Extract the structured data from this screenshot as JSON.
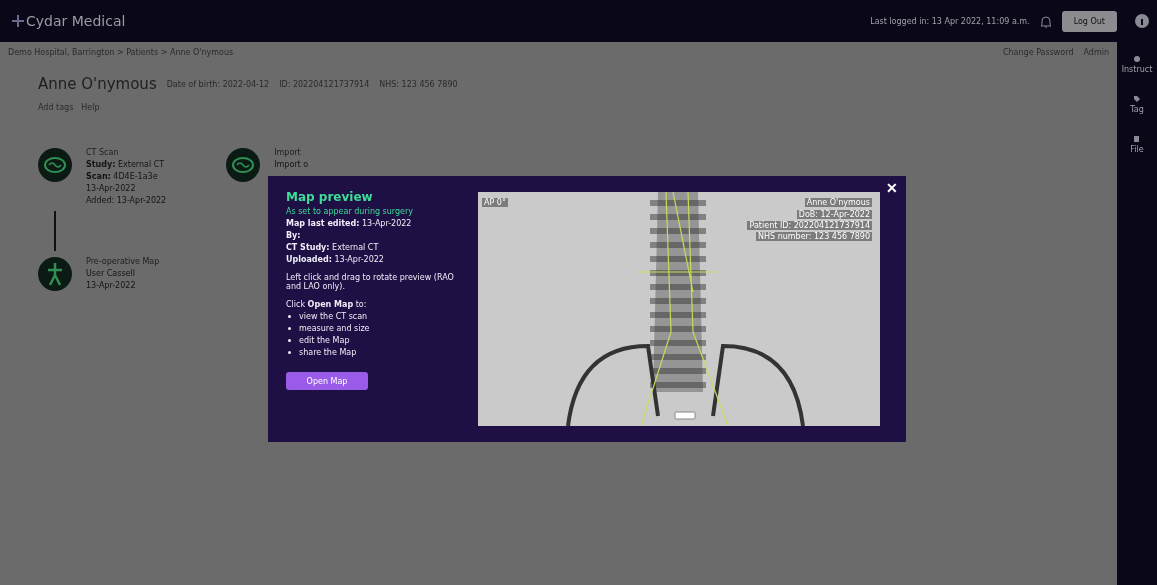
{
  "header": {
    "logo": "Cydar Medical",
    "last_login": "Last logged in: 13 Apr 2022, 11:09 a.m.",
    "logout": "Log Out"
  },
  "breadcrumb": "Demo Hospital, Barrington > Patients > Anne O'nymous",
  "account_links": [
    "Change Password",
    "Admin"
  ],
  "sidebar": {
    "items": [
      {
        "label": "Instruct",
        "kind": "info"
      },
      {
        "label": "Tag",
        "kind": "tag"
      },
      {
        "label": "File",
        "kind": "file"
      }
    ]
  },
  "patient": {
    "name": "Anne O'nymous",
    "details": [
      "Date of birth: 2022-04-12",
      "ID: 202204121737914",
      "NHS: 123 456 7890"
    ],
    "actions": [
      "Add tags",
      "Help"
    ]
  },
  "timeline": [
    {
      "kind": "scan",
      "title": "CT Scan",
      "lines": [
        "**Study:** External CT",
        "**Scan:** 4D4E-1a3e",
        "13-Apr-2022",
        "Added: 13-Apr-2022"
      ]
    },
    {
      "kind": "map",
      "title": "Pre-operative Map",
      "lines": [
        "User Cassell",
        "13-Apr-2022"
      ]
    }
  ],
  "import_item": {
    "title": "Import",
    "subtitle": "Import o"
  },
  "modal": {
    "title": "Map preview",
    "subtitle": "As set to appear during surgery",
    "fields": [
      "**Map last edited:** 13-Apr-2022",
      "**By:**",
      "**CT Study:** External CT",
      "**Uploaded:** 13-Apr-2022"
    ],
    "hint": "Left click and drag to rotate preview (RAO and LAO only).",
    "intro": "Click **Open Map** to:",
    "bullets": [
      "view the CT scan",
      "measure and size",
      "edit the Map",
      "share the Map"
    ],
    "button": "Open Map",
    "close": "✕",
    "preview": {
      "view": "AP 0°",
      "name": "Anne O'nymous",
      "lines": [
        "DoB: 12-Apr-2022",
        "Patient ID: 202204121737914",
        "NHS number: 123 456 7890"
      ]
    }
  }
}
